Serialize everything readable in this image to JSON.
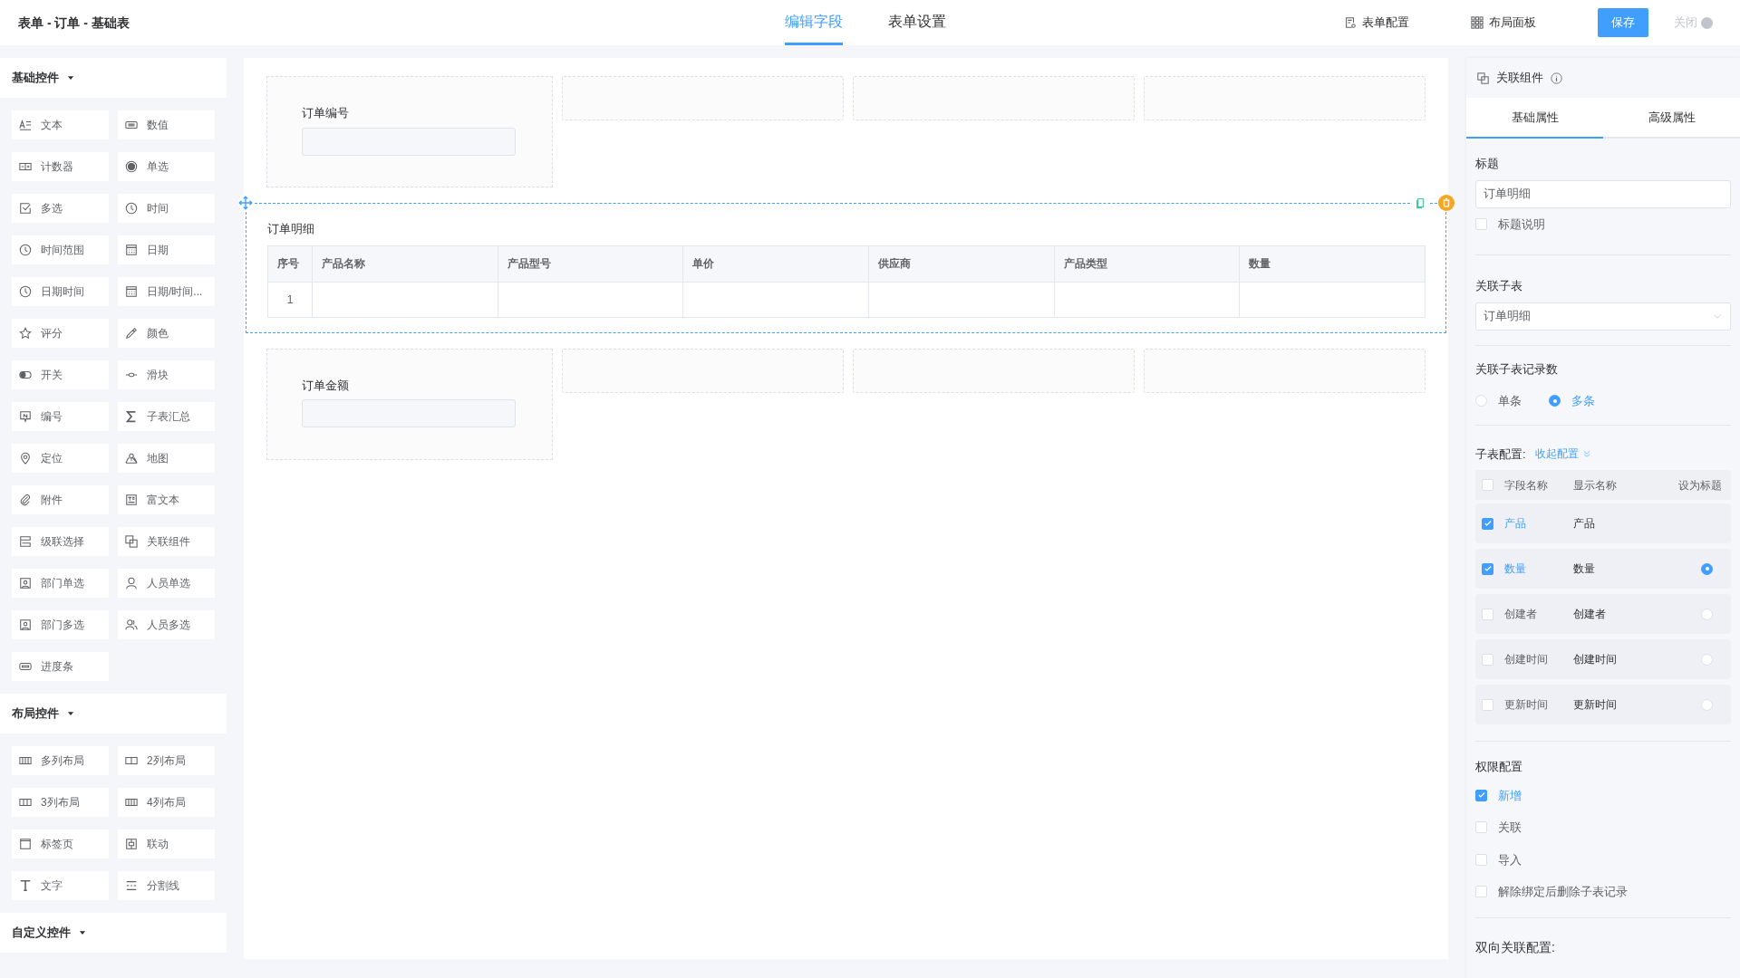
{
  "header": {
    "title": "表单 - 订单 - 基础表",
    "tabs": [
      {
        "label": "编辑字段",
        "selected": true
      },
      {
        "label": "表单设置",
        "selected": false
      }
    ],
    "actions": [
      {
        "kind": "config",
        "label": "表单配置"
      },
      {
        "kind": "layout",
        "label": "布局面板"
      }
    ],
    "save": "保存",
    "close": "关闭"
  },
  "palette": [
    {
      "title": "基础控件",
      "expanded": true,
      "items": [
        {
          "kind": "text",
          "label": "文本"
        },
        {
          "kind": "number",
          "label": "数值"
        },
        {
          "kind": "counter",
          "label": "计数器"
        },
        {
          "kind": "radio",
          "label": "单选"
        },
        {
          "kind": "checkbox",
          "label": "多选"
        },
        {
          "kind": "clock",
          "label": "时间"
        },
        {
          "kind": "clock",
          "label": "时间范围"
        },
        {
          "kind": "calendar",
          "label": "日期"
        },
        {
          "kind": "clock",
          "label": "日期时间"
        },
        {
          "kind": "calendar",
          "label": "日期/时间..."
        },
        {
          "kind": "star",
          "label": "评分"
        },
        {
          "kind": "picker",
          "label": "颜色"
        },
        {
          "kind": "toggle",
          "label": "开关"
        },
        {
          "kind": "slider",
          "label": "滑块"
        },
        {
          "kind": "serial",
          "label": "编号"
        },
        {
          "kind": "sigma",
          "label": "子表汇总"
        },
        {
          "kind": "pin",
          "label": "定位"
        },
        {
          "kind": "map",
          "label": "地图"
        },
        {
          "kind": "clip",
          "label": "附件"
        },
        {
          "kind": "richtext",
          "label": "富文本"
        },
        {
          "kind": "cascade",
          "label": "级联选择"
        },
        {
          "kind": "link",
          "label": "关联组件"
        },
        {
          "kind": "dept",
          "label": "部门单选"
        },
        {
          "kind": "person",
          "label": "人员单选"
        },
        {
          "kind": "dept",
          "label": "部门多选"
        },
        {
          "kind": "people",
          "label": "人员多选"
        },
        {
          "kind": "progress",
          "label": "进度条"
        }
      ]
    },
    {
      "title": "布局控件",
      "expanded": true,
      "items": [
        {
          "kind": "cols4",
          "label": "多列布局"
        },
        {
          "kind": "cols2",
          "label": "2列布局"
        },
        {
          "kind": "cols3",
          "label": "3列布局"
        },
        {
          "kind": "cols4",
          "label": "4列布局"
        },
        {
          "kind": "tabs",
          "label": "标签页"
        },
        {
          "kind": "linkage",
          "label": "联动"
        },
        {
          "kind": "type",
          "label": "文字"
        },
        {
          "kind": "divider",
          "label": "分割线"
        }
      ]
    },
    {
      "title": "自定义控件",
      "expanded": true
    }
  ],
  "canvas": {
    "rows": [
      {
        "kind": "fields",
        "slots": [
          {
            "kind": "field",
            "label": "订单编号"
          },
          {
            "kind": "empty"
          },
          {
            "kind": "empty"
          },
          {
            "kind": "empty"
          }
        ]
      },
      {
        "kind": "subtable",
        "title": "订单明细",
        "selected": true,
        "columns": [
          "序号",
          "产品名称",
          "产品型号",
          "单价",
          "供应商",
          "产品类型",
          "数量"
        ],
        "rows": [
          {
            "index": "1"
          }
        ]
      },
      {
        "kind": "fields",
        "slots": [
          {
            "kind": "field",
            "label": "订单金额"
          },
          {
            "kind": "empty"
          },
          {
            "kind": "empty"
          },
          {
            "kind": "empty"
          }
        ]
      }
    ]
  },
  "inspector": {
    "component": "关联组件",
    "tabs": [
      {
        "label": "基础属性",
        "selected": true
      },
      {
        "label": "高级属性",
        "selected": false
      }
    ],
    "title_label": "标题",
    "title_value": "订单明细",
    "title_note": {
      "label": "标题说明",
      "checked": false
    },
    "subtable_label": "关联子表",
    "subtable_value": "订单明细",
    "count_label": "关联子表记录数",
    "count_options": [
      {
        "label": "单条",
        "selected": false
      },
      {
        "label": "多条",
        "selected": true
      }
    ],
    "config_label": "子表配置:",
    "config_toggle": "收起配置",
    "config_header": {
      "checked": false,
      "columns": [
        "字段名称",
        "显示名称",
        "设为标题"
      ]
    },
    "config_rows": [
      {
        "kind": "plain",
        "field": "产品",
        "display": "产品",
        "checked": true
      },
      {
        "kind": "radio",
        "field": "数量",
        "display": "数量",
        "checked": true,
        "selected": true
      },
      {
        "kind": "radio",
        "field": "创建者",
        "display": "创建者",
        "checked": false,
        "selected": false
      },
      {
        "kind": "radio",
        "field": "创建时间",
        "display": "创建时间",
        "checked": false,
        "selected": false
      },
      {
        "kind": "radio",
        "field": "更新时间",
        "display": "更新时间",
        "checked": false,
        "selected": false
      }
    ],
    "permissions_label": "权限配置",
    "permissions": [
      {
        "label": "新增",
        "checked": true
      },
      {
        "label": "关联",
        "checked": false
      },
      {
        "label": "导入",
        "checked": false
      },
      {
        "label": "解除绑定后删除子表记录",
        "checked": false
      }
    ],
    "two_way_label": "双向关联配置:"
  }
}
